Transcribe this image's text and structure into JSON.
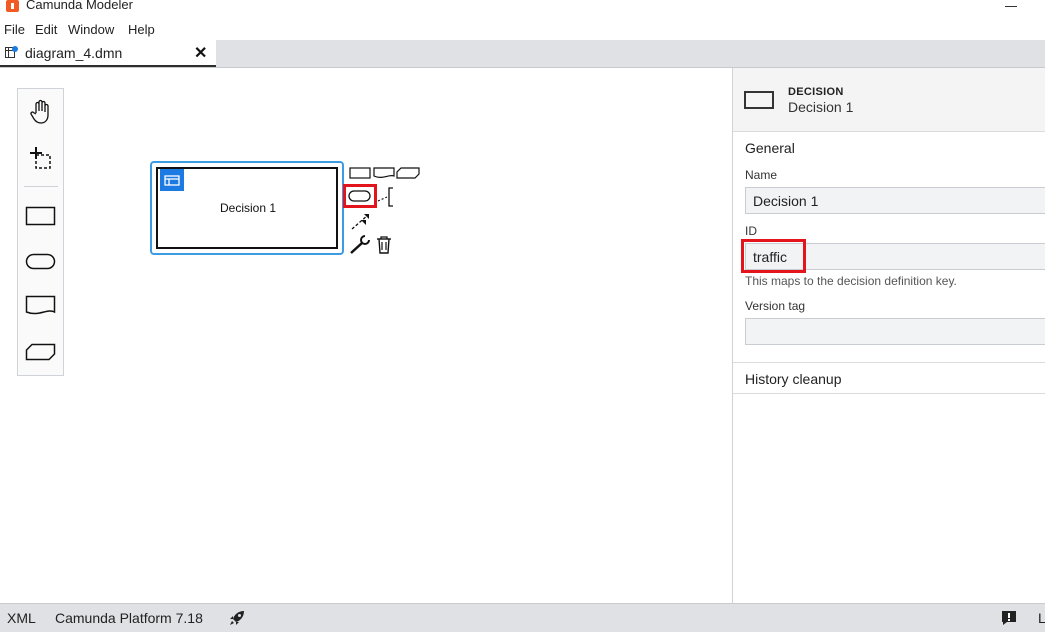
{
  "window": {
    "title": "Camunda Modeler"
  },
  "menu": [
    "File",
    "Edit",
    "Window",
    "Help"
  ],
  "tab": {
    "label": "diagram_4.dmn",
    "close": "✕"
  },
  "canvas": {
    "palette": [
      "hand-tool",
      "lasso-tool",
      "create-decision",
      "create-input-data",
      "create-knowledge-source",
      "create-business-knowledge-model"
    ],
    "decision": {
      "label": "Decision 1"
    }
  },
  "properties": {
    "element_type": "DECISION",
    "element_name": "Decision 1",
    "general_title": "General",
    "name_label": "Name",
    "name_value": "Decision 1",
    "id_label": "ID",
    "id_value": "traffic",
    "id_description": "This maps to the decision definition key.",
    "version_tag_label": "Version tag",
    "version_tag_value": "",
    "history_cleanup_title": "History cleanup"
  },
  "statusbar": {
    "xml": "XML",
    "platform": "Camunda Platform 7.18",
    "cut_off": "L"
  },
  "colors": {
    "selection": "#3c9be3",
    "highlight": "#e3141b",
    "badge": "#1c7be3"
  }
}
